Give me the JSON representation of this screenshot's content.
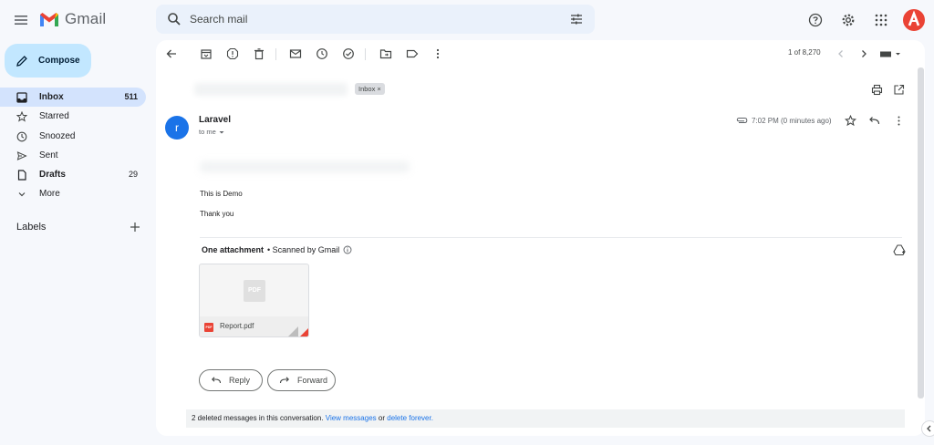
{
  "app": {
    "name": "Gmail",
    "search_placeholder": "Search mail",
    "accent": "#c2e7ff",
    "avatar_color": "#ea4335"
  },
  "sidebar": {
    "compose_label": "Compose",
    "items": [
      {
        "label": "Inbox",
        "count": "511",
        "icon": "inbox-icon"
      },
      {
        "label": "Starred",
        "count": "",
        "icon": "star-icon"
      },
      {
        "label": "Snoozed",
        "count": "",
        "icon": "clock-icon"
      },
      {
        "label": "Sent",
        "count": "",
        "icon": "send-icon"
      },
      {
        "label": "Drafts",
        "count": "29",
        "icon": "draft-icon"
      },
      {
        "label": "More",
        "count": "",
        "icon": "chevron-down-icon"
      }
    ],
    "labels_title": "Labels",
    "labels_add": "+"
  },
  "toolbar": {
    "pager": "1 of 8,270"
  },
  "thread": {
    "label_chip": "Inbox ×",
    "sender_initial": "r",
    "sender_name": "Laravel",
    "to_me": "to me",
    "time": "7:02 PM (0 minutes ago)",
    "body_lines": [
      "This is Demo",
      "Thank you"
    ],
    "attachment_count": "One attachment",
    "scanned_by": "• Scanned by Gmail",
    "attachment_name": "Report.pdf",
    "pdf_badge": "PDF",
    "reply_label": "Reply",
    "forward_label": "Forward",
    "deleted_notice": "2 deleted messages in this conversation.",
    "view_messages_link": "View messages",
    "or_text": "or",
    "delete_forever_link": "delete forever."
  }
}
